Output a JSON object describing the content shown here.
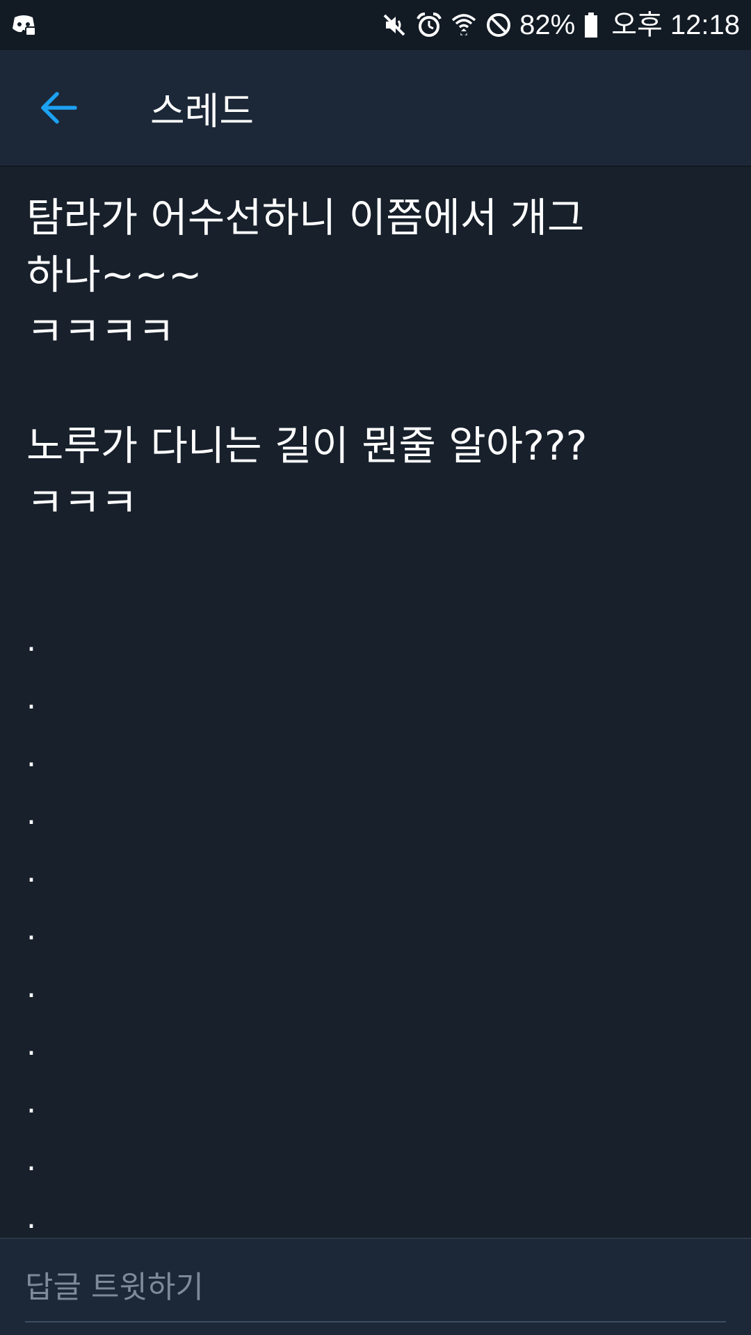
{
  "status_bar": {
    "battery_percent": "82%",
    "time": "오후 12:18",
    "icons": [
      "discord-icon",
      "mute-icon",
      "alarm-icon",
      "wifi-icon",
      "do-not-disturb-icon",
      "battery-icon"
    ]
  },
  "app_bar": {
    "title": "스레드",
    "back_icon": "arrow-left-icon",
    "accent_color": "#1da1f2"
  },
  "tweet": {
    "lines": [
      "탐라가 어수선하니 이쯤에서 개그",
      "하나~~~",
      "ㅋㅋㅋㅋ",
      "",
      "노루가 다니는 길이 뭔줄 알아???",
      "ㅋㅋㅋ"
    ],
    "dots": [
      ".",
      ".",
      ".",
      ".",
      ".",
      ".",
      ".",
      ".",
      ".",
      ".",
      "."
    ]
  },
  "reply": {
    "placeholder": "답글 트윗하기",
    "value": ""
  },
  "colors": {
    "background": "#17202b",
    "bar": "#1c2838",
    "status_bar": "#121a24",
    "text": "#ffffff",
    "placeholder": "#7d8a99"
  }
}
